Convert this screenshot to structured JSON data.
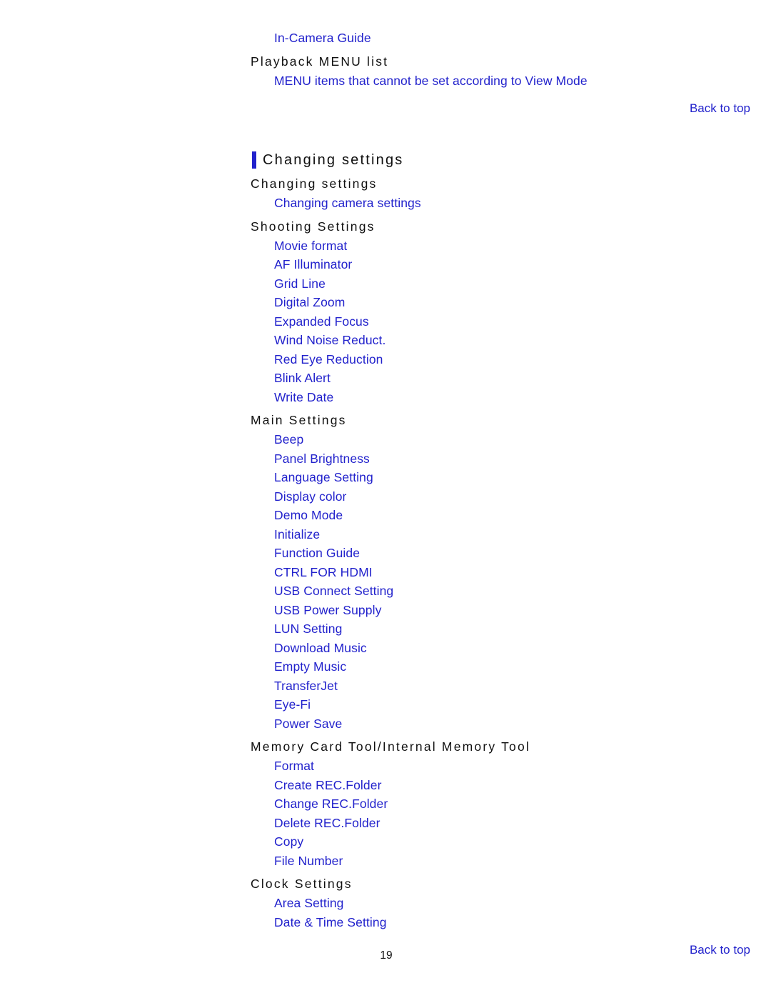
{
  "document": {
    "page_number": "19",
    "link_color": "#2222cc",
    "heading_color": "#101010",
    "background_color": "#ffffff",
    "accent_bar_color": "#2222cc"
  },
  "top_fragment": {
    "leading_link": "In-Camera Guide",
    "heading": "Playback MENU list",
    "sub_link": "MENU items that cannot be set according to View Mode",
    "back_to_top": "Back to top"
  },
  "section": {
    "title": "Changing settings",
    "groups": [
      {
        "heading": "Changing settings",
        "items": [
          "Changing camera settings"
        ]
      },
      {
        "heading": "Shooting Settings",
        "items": [
          "Movie format",
          "AF Illuminator",
          "Grid Line",
          "Digital Zoom",
          "Expanded Focus",
          "Wind Noise Reduct.",
          "Red Eye Reduction",
          "Blink Alert",
          "Write Date"
        ]
      },
      {
        "heading": "Main Settings",
        "items": [
          "Beep",
          "Panel Brightness",
          "Language Setting",
          "Display color",
          "Demo Mode",
          "Initialize",
          "Function Guide",
          "CTRL FOR HDMI",
          "USB Connect Setting",
          "USB Power Supply",
          "LUN Setting",
          "Download Music",
          "Empty Music",
          "TransferJet",
          "Eye-Fi",
          "Power Save"
        ]
      },
      {
        "heading": "Memory Card Tool/Internal Memory Tool",
        "items": [
          "Format",
          "Create REC.Folder",
          "Change REC.Folder",
          "Delete REC.Folder",
          "Copy",
          "File Number"
        ]
      },
      {
        "heading": "Clock Settings",
        "items": [
          "Area Setting",
          "Date & Time Setting"
        ]
      }
    ],
    "back_to_top": "Back to top"
  }
}
